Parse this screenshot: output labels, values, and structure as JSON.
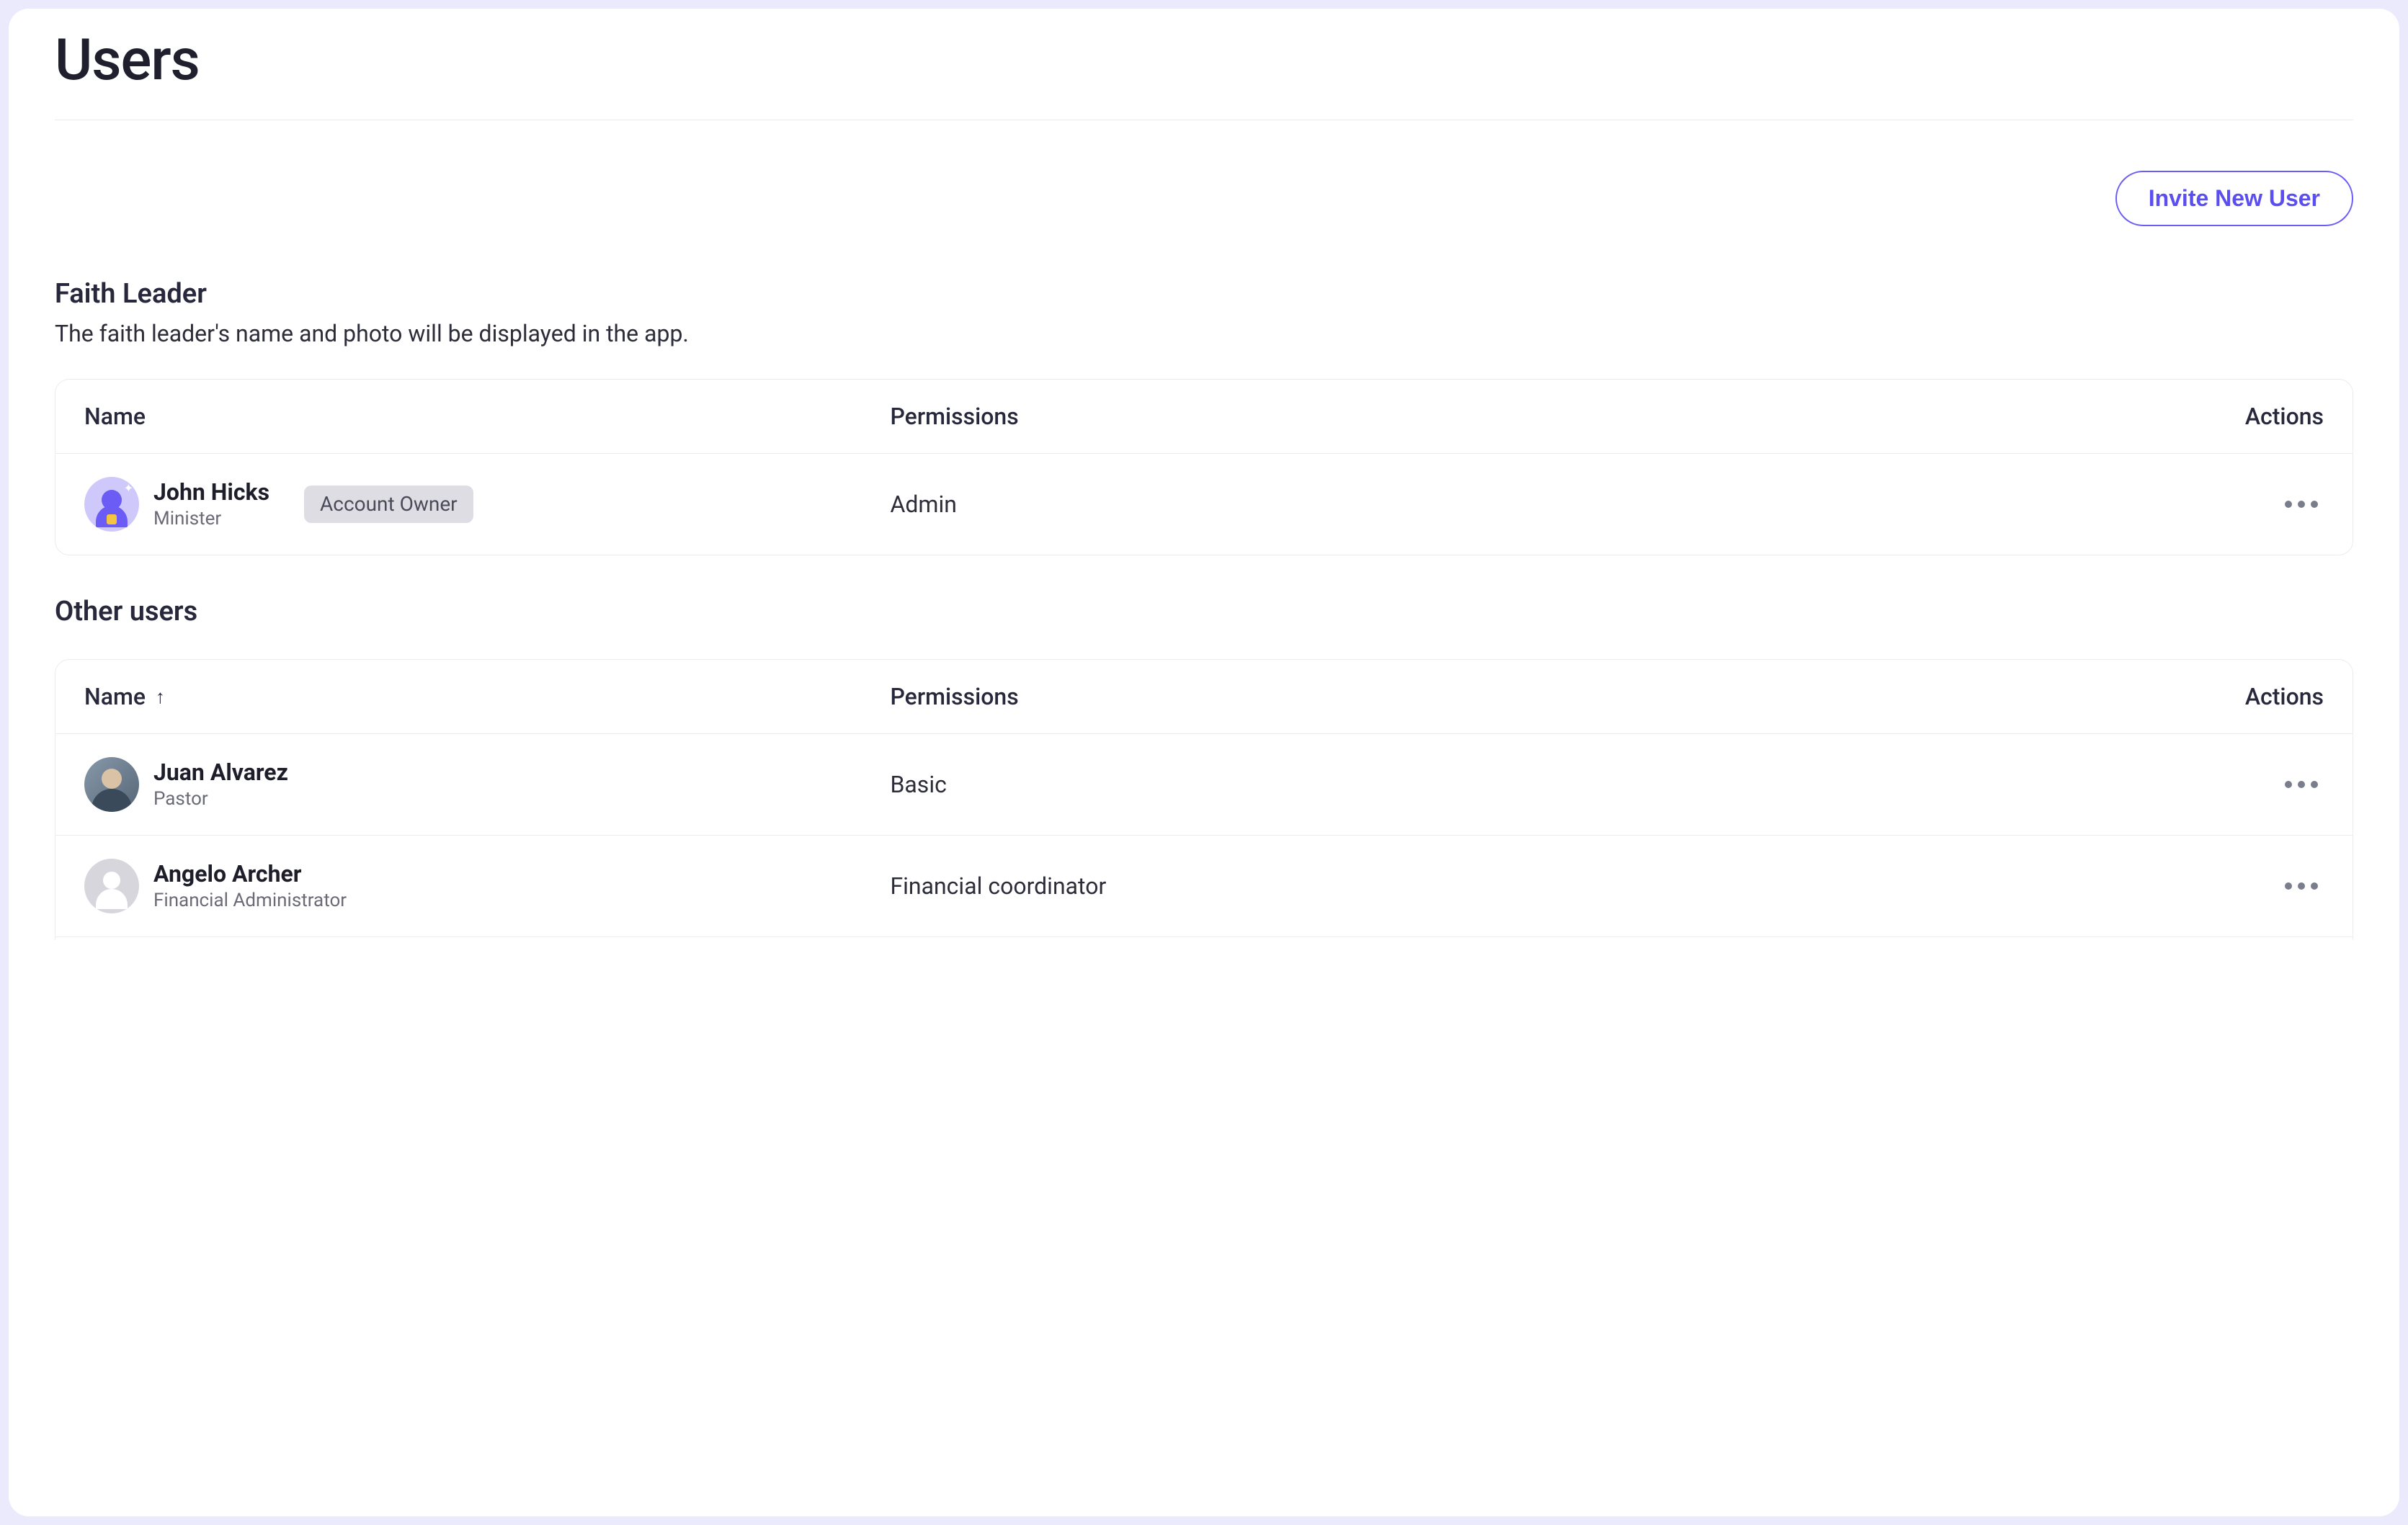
{
  "page": {
    "title": "Users"
  },
  "actions": {
    "invite": "Invite New User"
  },
  "faith_leader": {
    "title": "Faith Leader",
    "subtitle": "The faith leader's name and photo will be displayed in the app.",
    "columns": {
      "name": "Name",
      "permissions": "Permissions",
      "actions": "Actions"
    },
    "row": {
      "name": "John Hicks",
      "role": "Minister",
      "badge": "Account Owner",
      "permissions": "Admin"
    }
  },
  "other_users": {
    "title": "Other users",
    "columns": {
      "name": "Name",
      "permissions": "Permissions",
      "actions": "Actions"
    },
    "rows": [
      {
        "name": "Juan Alvarez",
        "role": "Pastor",
        "permissions": "Basic"
      },
      {
        "name": "Angelo Archer",
        "role": "Financial Administrator",
        "permissions": "Financial coordinator"
      }
    ]
  }
}
